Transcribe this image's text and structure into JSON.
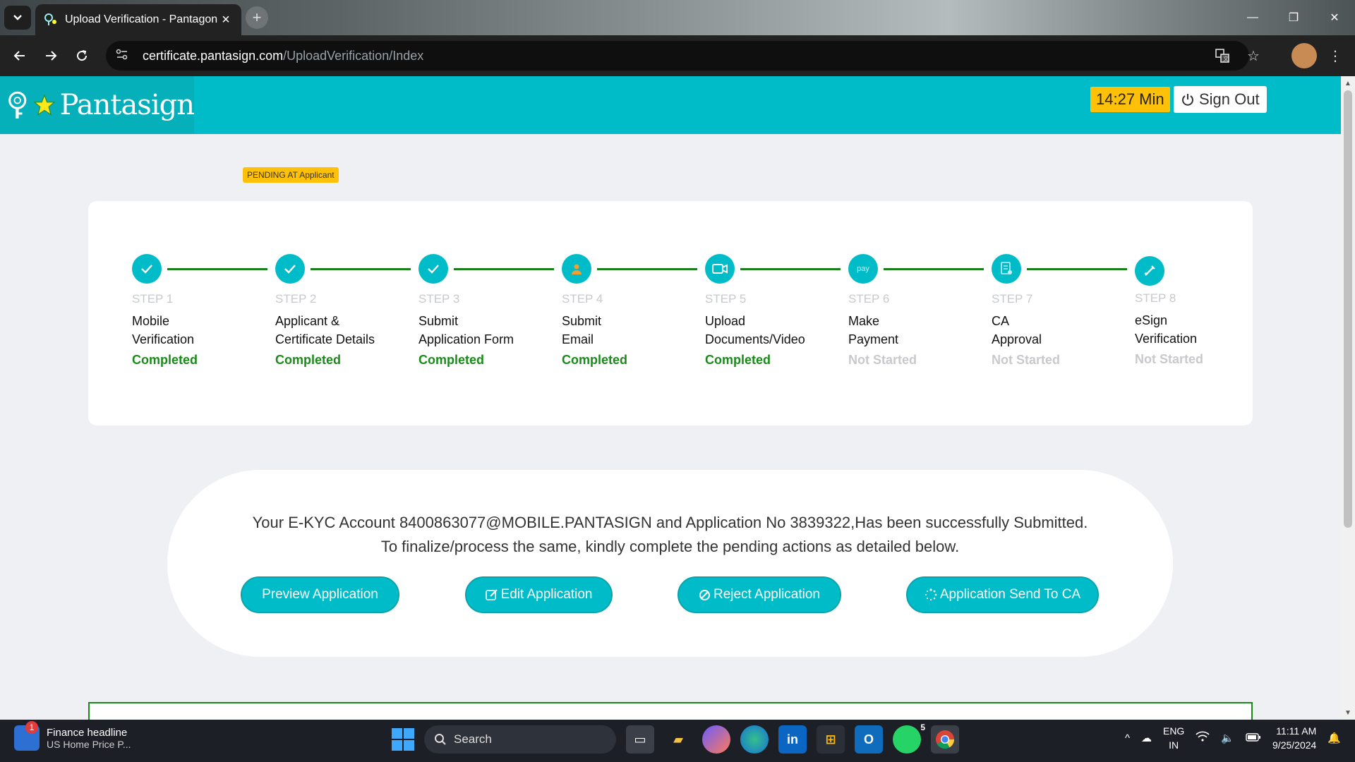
{
  "browser": {
    "tab_title": "Upload Verification - Pantagon",
    "url_domain": "certificate.pantasign.com",
    "url_path": "/UploadVerification/Index"
  },
  "header": {
    "logo_text": "Pantasign",
    "timer": "14:27 Min",
    "signout_label": "Sign Out"
  },
  "badge": "PENDING AT Applicant",
  "steps": [
    {
      "num": "STEP 1",
      "label_1": "Mobile",
      "label_2": "Verification",
      "status": "Completed",
      "icon": "check-icon"
    },
    {
      "num": "STEP 2",
      "label_1": "Applicant &",
      "label_2": "Certificate Details",
      "status": "Completed",
      "icon": "check-icon"
    },
    {
      "num": "STEP 3",
      "label_1": "Submit",
      "label_2": "Application Form",
      "status": "Completed",
      "icon": "check-icon"
    },
    {
      "num": "STEP 4",
      "label_1": "Submit",
      "label_2": "Email",
      "status": "Completed",
      "icon": "person-icon"
    },
    {
      "num": "STEP 5",
      "label_1": "Upload",
      "label_2": "Documents/Video",
      "status": "Completed",
      "icon": "video-icon"
    },
    {
      "num": "STEP 6",
      "label_1": "Make",
      "label_2": "Payment",
      "status": "Not Started",
      "icon": "pay-icon"
    },
    {
      "num": "STEP 7",
      "label_1": "CA",
      "label_2": "Approval",
      "status": "Not Started",
      "icon": "document-icon"
    },
    {
      "num": "STEP 8",
      "label_1": "eSign",
      "label_2": "Verification",
      "status": "Not Started",
      "icon": "pen-icon"
    }
  ],
  "message": {
    "line1": "Your E-KYC Account 8400863077@MOBILE.PANTASIGN and Application No 3839322,Has been successfully Submitted.",
    "line2": "To finalize/process the same, kindly complete the pending actions as detailed below."
  },
  "actions": {
    "preview": "Preview Application",
    "edit": "Edit Application",
    "reject": "Reject Application",
    "send": "Application Send To CA"
  },
  "taskbar": {
    "news_headline": "Finance headline",
    "news_sub": "US Home Price P...",
    "news_badge": "1",
    "search": "Search",
    "whatsapp_badge": "5",
    "lang_1": "ENG",
    "lang_2": "IN",
    "time": "11:11 AM",
    "date": "9/25/2024"
  },
  "colors": {
    "accent": "#00bcc8",
    "completed": "#1a8a1a",
    "badge": "#ffc107"
  }
}
